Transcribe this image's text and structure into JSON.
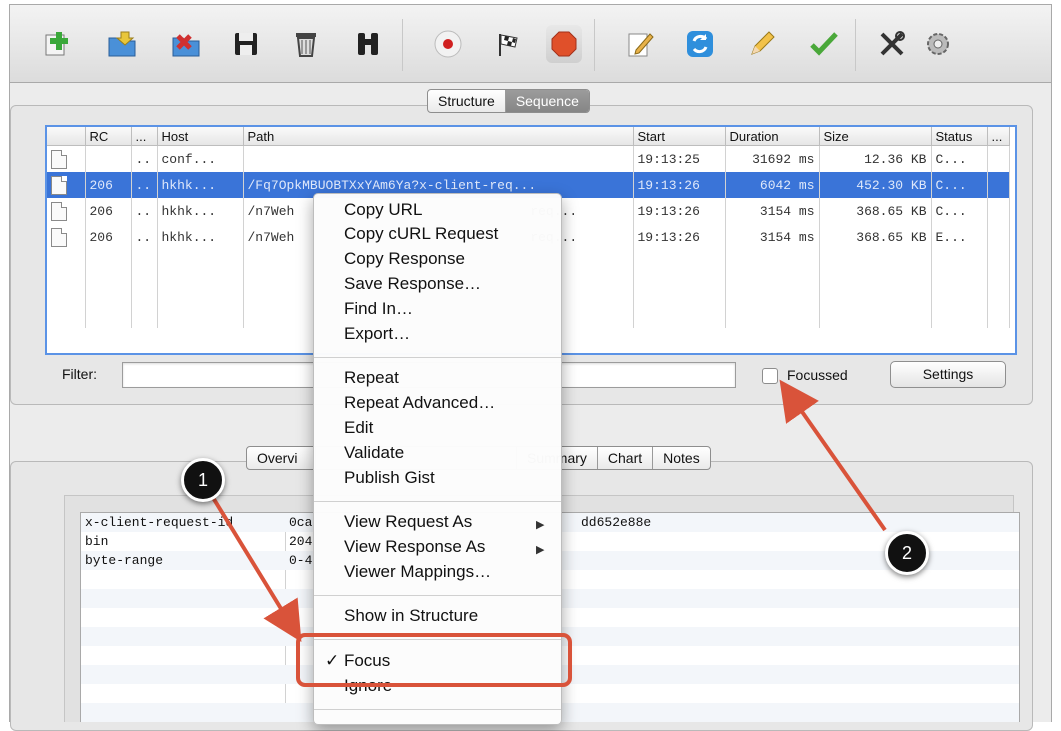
{
  "toolbar": {
    "buttons": [
      {
        "icon": "add-icon"
      },
      {
        "icon": "folder-open-icon"
      },
      {
        "icon": "close-session-icon"
      },
      {
        "icon": "save-icon"
      },
      {
        "icon": "trash-icon"
      },
      {
        "icon": "binoculars-icon"
      },
      {
        "icon": "record-icon"
      },
      {
        "icon": "checkered-flag-icon"
      },
      {
        "icon": "stop-icon"
      },
      {
        "icon": "compose-icon"
      },
      {
        "icon": "refresh-icon"
      },
      {
        "icon": "pencil-icon"
      },
      {
        "icon": "checkmark-icon"
      },
      {
        "icon": "tools-icon"
      },
      {
        "icon": "gear-icon"
      }
    ]
  },
  "view_tabs": {
    "structure": "Structure",
    "sequence": "Sequence"
  },
  "request_table": {
    "columns": [
      "",
      "RC",
      "...",
      "Host",
      "Path",
      "Start",
      "Duration",
      "Size",
      "Status",
      "..."
    ],
    "rows": [
      {
        "rc": "",
        "dots": "..",
        "host": "conf...",
        "path": "",
        "start": "19:13:25",
        "duration": "31692 ms",
        "size": "12.36 KB",
        "status": "C..."
      },
      {
        "rc": "206",
        "dots": "..",
        "host": "hkhk...",
        "path": "/Fq7OpkMBUOBTXxYAm6Ya?x-client-req...",
        "start": "19:13:26",
        "duration": "6042 ms",
        "size": "452.30 KB",
        "status": "C..."
      },
      {
        "rc": "206",
        "dots": "..",
        "host": "hkhk...",
        "path": "/n7Weh",
        "path_tail": "req...",
        "start": "19:13:26",
        "duration": "3154 ms",
        "size": "368.65 KB",
        "status": "C..."
      },
      {
        "rc": "206",
        "dots": "..",
        "host": "hkhk...",
        "path": "/n7Weh",
        "path_tail": "req...",
        "start": "19:13:26",
        "duration": "3154 ms",
        "size": "368.65 KB",
        "status": "E..."
      }
    ]
  },
  "filter": {
    "label": "Filter:",
    "value": "",
    "focussed_label": "Focussed",
    "settings_label": "Settings"
  },
  "detail_tabs": [
    "Overvi",
    "Summary",
    "Chart",
    "Notes"
  ],
  "headers": [
    {
      "name": "x-client-request-id",
      "value": "0ca",
      "value_tail": "dd652e88e"
    },
    {
      "name": "bin",
      "value": "204"
    },
    {
      "name": "byte-range",
      "value": "0-4"
    }
  ],
  "context_menu": {
    "group1": [
      "Copy URL",
      "Copy cURL Request",
      "Copy Response",
      "Save Response…",
      "Find In…",
      "Export…"
    ],
    "group2": [
      "Repeat",
      "Repeat Advanced…",
      "Edit",
      "Validate",
      "Publish Gist"
    ],
    "group3": [
      "View Request As",
      "View Response As",
      "Viewer Mappings…"
    ],
    "group4": [
      "Show in Structure"
    ],
    "focus": "✓ Focus",
    "ignore": "Ignore"
  },
  "callouts": {
    "one": "1",
    "two": "2"
  },
  "colors": {
    "selection": "#3a74d8",
    "annotation": "#d9533a"
  }
}
